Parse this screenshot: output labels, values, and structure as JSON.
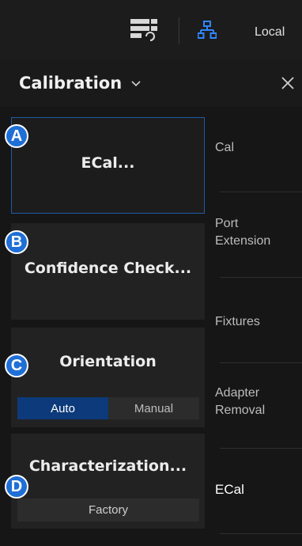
{
  "topbar": {
    "grid_icon": "grid-sync-icon",
    "network_icon": "network-icon",
    "local_label": "Local",
    "accent_color": "#1f6fd6"
  },
  "header": {
    "title": "Calibration",
    "dropdown_icon": "chevron-down-icon",
    "close_icon": "close-icon"
  },
  "left_panel": {
    "ecal": {
      "label": "ECal...",
      "badge": "A"
    },
    "confidence": {
      "label": "Confidence Check...",
      "badge": "B"
    },
    "orientation": {
      "label": "Orientation",
      "badge": "C",
      "options": [
        "Auto",
        "Manual"
      ],
      "selected": "Auto"
    },
    "characterization": {
      "label": "Characterization...",
      "badge": "D",
      "value": "Factory"
    }
  },
  "right_nav": {
    "items": [
      {
        "label": "Cal"
      },
      {
        "label": "Port Extension"
      },
      {
        "label": "Fixtures"
      },
      {
        "label": "Adapter Removal"
      },
      {
        "label": "ECal"
      }
    ],
    "active": "ECal"
  }
}
